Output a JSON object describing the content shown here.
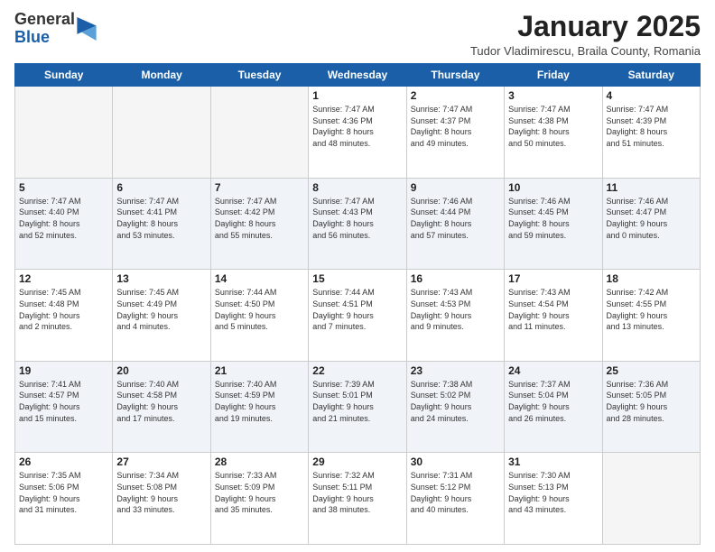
{
  "logo": {
    "general": "General",
    "blue": "Blue"
  },
  "header": {
    "title": "January 2025",
    "location": "Tudor Vladimirescu, Braila County, Romania"
  },
  "weekdays": [
    "Sunday",
    "Monday",
    "Tuesday",
    "Wednesday",
    "Thursday",
    "Friday",
    "Saturday"
  ],
  "weeks": [
    [
      {
        "day": "",
        "info": ""
      },
      {
        "day": "",
        "info": ""
      },
      {
        "day": "",
        "info": ""
      },
      {
        "day": "1",
        "info": "Sunrise: 7:47 AM\nSunset: 4:36 PM\nDaylight: 8 hours\nand 48 minutes."
      },
      {
        "day": "2",
        "info": "Sunrise: 7:47 AM\nSunset: 4:37 PM\nDaylight: 8 hours\nand 49 minutes."
      },
      {
        "day": "3",
        "info": "Sunrise: 7:47 AM\nSunset: 4:38 PM\nDaylight: 8 hours\nand 50 minutes."
      },
      {
        "day": "4",
        "info": "Sunrise: 7:47 AM\nSunset: 4:39 PM\nDaylight: 8 hours\nand 51 minutes."
      }
    ],
    [
      {
        "day": "5",
        "info": "Sunrise: 7:47 AM\nSunset: 4:40 PM\nDaylight: 8 hours\nand 52 minutes."
      },
      {
        "day": "6",
        "info": "Sunrise: 7:47 AM\nSunset: 4:41 PM\nDaylight: 8 hours\nand 53 minutes."
      },
      {
        "day": "7",
        "info": "Sunrise: 7:47 AM\nSunset: 4:42 PM\nDaylight: 8 hours\nand 55 minutes."
      },
      {
        "day": "8",
        "info": "Sunrise: 7:47 AM\nSunset: 4:43 PM\nDaylight: 8 hours\nand 56 minutes."
      },
      {
        "day": "9",
        "info": "Sunrise: 7:46 AM\nSunset: 4:44 PM\nDaylight: 8 hours\nand 57 minutes."
      },
      {
        "day": "10",
        "info": "Sunrise: 7:46 AM\nSunset: 4:45 PM\nDaylight: 8 hours\nand 59 minutes."
      },
      {
        "day": "11",
        "info": "Sunrise: 7:46 AM\nSunset: 4:47 PM\nDaylight: 9 hours\nand 0 minutes."
      }
    ],
    [
      {
        "day": "12",
        "info": "Sunrise: 7:45 AM\nSunset: 4:48 PM\nDaylight: 9 hours\nand 2 minutes."
      },
      {
        "day": "13",
        "info": "Sunrise: 7:45 AM\nSunset: 4:49 PM\nDaylight: 9 hours\nand 4 minutes."
      },
      {
        "day": "14",
        "info": "Sunrise: 7:44 AM\nSunset: 4:50 PM\nDaylight: 9 hours\nand 5 minutes."
      },
      {
        "day": "15",
        "info": "Sunrise: 7:44 AM\nSunset: 4:51 PM\nDaylight: 9 hours\nand 7 minutes."
      },
      {
        "day": "16",
        "info": "Sunrise: 7:43 AM\nSunset: 4:53 PM\nDaylight: 9 hours\nand 9 minutes."
      },
      {
        "day": "17",
        "info": "Sunrise: 7:43 AM\nSunset: 4:54 PM\nDaylight: 9 hours\nand 11 minutes."
      },
      {
        "day": "18",
        "info": "Sunrise: 7:42 AM\nSunset: 4:55 PM\nDaylight: 9 hours\nand 13 minutes."
      }
    ],
    [
      {
        "day": "19",
        "info": "Sunrise: 7:41 AM\nSunset: 4:57 PM\nDaylight: 9 hours\nand 15 minutes."
      },
      {
        "day": "20",
        "info": "Sunrise: 7:40 AM\nSunset: 4:58 PM\nDaylight: 9 hours\nand 17 minutes."
      },
      {
        "day": "21",
        "info": "Sunrise: 7:40 AM\nSunset: 4:59 PM\nDaylight: 9 hours\nand 19 minutes."
      },
      {
        "day": "22",
        "info": "Sunrise: 7:39 AM\nSunset: 5:01 PM\nDaylight: 9 hours\nand 21 minutes."
      },
      {
        "day": "23",
        "info": "Sunrise: 7:38 AM\nSunset: 5:02 PM\nDaylight: 9 hours\nand 24 minutes."
      },
      {
        "day": "24",
        "info": "Sunrise: 7:37 AM\nSunset: 5:04 PM\nDaylight: 9 hours\nand 26 minutes."
      },
      {
        "day": "25",
        "info": "Sunrise: 7:36 AM\nSunset: 5:05 PM\nDaylight: 9 hours\nand 28 minutes."
      }
    ],
    [
      {
        "day": "26",
        "info": "Sunrise: 7:35 AM\nSunset: 5:06 PM\nDaylight: 9 hours\nand 31 minutes."
      },
      {
        "day": "27",
        "info": "Sunrise: 7:34 AM\nSunset: 5:08 PM\nDaylight: 9 hours\nand 33 minutes."
      },
      {
        "day": "28",
        "info": "Sunrise: 7:33 AM\nSunset: 5:09 PM\nDaylight: 9 hours\nand 35 minutes."
      },
      {
        "day": "29",
        "info": "Sunrise: 7:32 AM\nSunset: 5:11 PM\nDaylight: 9 hours\nand 38 minutes."
      },
      {
        "day": "30",
        "info": "Sunrise: 7:31 AM\nSunset: 5:12 PM\nDaylight: 9 hours\nand 40 minutes."
      },
      {
        "day": "31",
        "info": "Sunrise: 7:30 AM\nSunset: 5:13 PM\nDaylight: 9 hours\nand 43 minutes."
      },
      {
        "day": "",
        "info": ""
      }
    ]
  ]
}
